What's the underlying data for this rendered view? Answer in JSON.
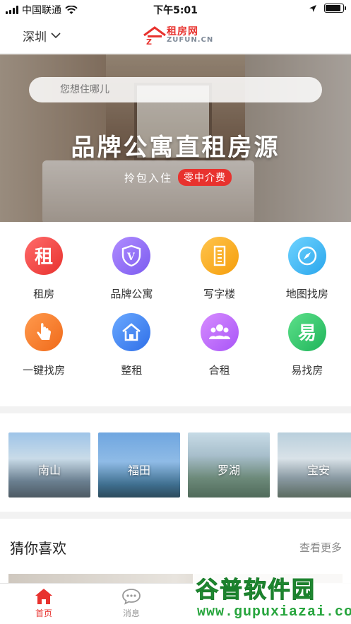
{
  "status_bar": {
    "carrier": "中国联通",
    "time": "下午5:01"
  },
  "header": {
    "city": "深圳",
    "logo_cn": "租房网",
    "logo_en": "ZUFUN.CN"
  },
  "search": {
    "placeholder": "您想住哪儿"
  },
  "banner": {
    "title": "品牌公寓直租房源",
    "subtitle": "拎包入住",
    "badge": "零中介费"
  },
  "quick_entries": [
    {
      "label": "租房",
      "icon": "zu-icon",
      "color": "#ef4444"
    },
    {
      "label": "品牌公寓",
      "icon": "shield-v-icon",
      "color": "#8b5cf6"
    },
    {
      "label": "写字楼",
      "icon": "office-building-icon",
      "color": "#f59e0b"
    },
    {
      "label": "地图找房",
      "icon": "compass-icon",
      "color": "#3bb4f2"
    },
    {
      "label": "一键找房",
      "icon": "tap-hand-icon",
      "color": "#f97316"
    },
    {
      "label": "整租",
      "icon": "house-icon",
      "color": "#3b82f6"
    },
    {
      "label": "合租",
      "icon": "people-icon",
      "color": "#a855f7"
    },
    {
      "label": "易找房",
      "icon": "yi-icon",
      "color": "#22c55e"
    }
  ],
  "districts": [
    {
      "label": "南山"
    },
    {
      "label": "福田"
    },
    {
      "label": "罗湖"
    },
    {
      "label": "宝安"
    }
  ],
  "guess": {
    "title": "猜你喜欢",
    "more": "查看更多"
  },
  "tabbar": [
    {
      "label": "首页",
      "icon": "home-icon",
      "active": true
    },
    {
      "label": "消息",
      "icon": "chat-bubble-icon",
      "active": false
    }
  ],
  "watermark": {
    "line1": "谷普软件园",
    "line2": "www.gupuxiazai.com"
  }
}
